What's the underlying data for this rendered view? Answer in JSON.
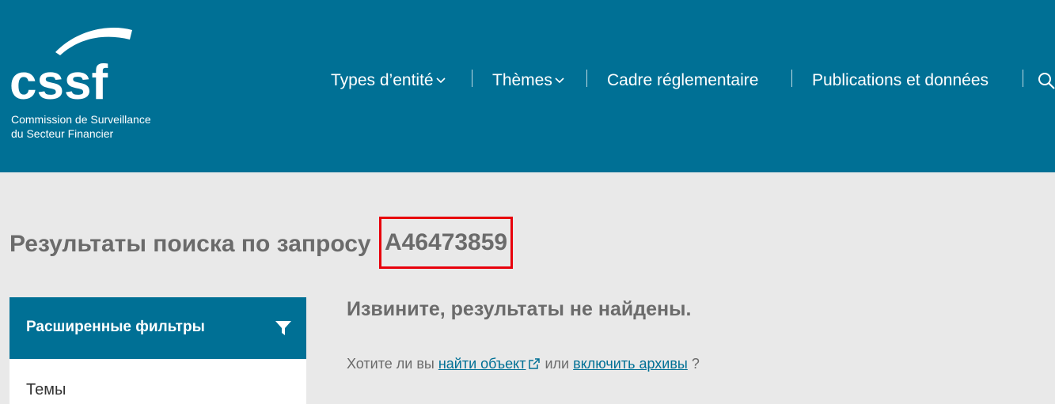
{
  "header": {
    "logo_text": "cssf",
    "logo_subtitle_line1": "Commission de Surveillance",
    "logo_subtitle_line2": "du Secteur Financier",
    "nav": [
      {
        "label": "Types d’entité",
        "has_dropdown": true
      },
      {
        "label": "Thèmes",
        "has_dropdown": true
      },
      {
        "label": "Cadre réglementaire",
        "has_dropdown": false
      },
      {
        "label": "Publications et données",
        "has_dropdown": false
      }
    ],
    "search_icon": "search-icon"
  },
  "main": {
    "title_prefix": "Результаты поиска по запросу",
    "query": "A46473859",
    "no_results": "Извините, результаты не найдены.",
    "suggestion": {
      "before": "Хотите ли вы",
      "link1": "найти объект",
      "middle": "или",
      "link2": "включить архивы",
      "after": "?"
    }
  },
  "filters": {
    "title": "Расширенные фильтры",
    "items": [
      "Темы"
    ]
  },
  "colors": {
    "brand": "#007095",
    "highlight": "#e8000b",
    "background": "#e9e9e9",
    "text": "#6b6b6b"
  }
}
